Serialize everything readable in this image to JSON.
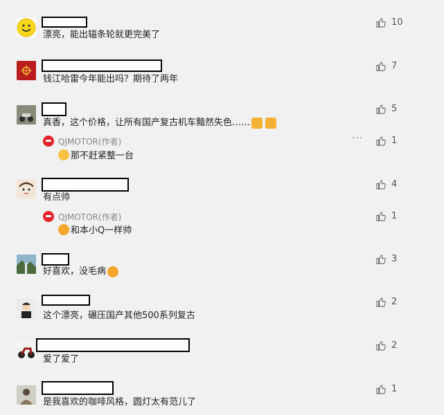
{
  "comments": [
    {
      "text": "漂亮，能出辐条轮就更完美了",
      "likes": "10",
      "avatar_icon": "smiley-face"
    },
    {
      "text": "钱江哈雷今年能出吗？期待了两年",
      "likes": "7",
      "avatar_icon": "red-emblem"
    },
    {
      "text": "真香，这个价格，让所有国产复古机车黯然失色……",
      "likes": "5",
      "avatar_icon": "motorcycle-photo",
      "reply": {
        "name": "QJMOTOR(作者)",
        "text": "那不赶紧整一台",
        "likes": "1"
      }
    },
    {
      "text": "有点帅",
      "likes": "4",
      "avatar_icon": "cartoon-face",
      "reply": {
        "name": "QJMOTOR(作者)",
        "text": "和本小Q一样帅",
        "likes": "1"
      }
    },
    {
      "text": "好喜欢，没毛病",
      "likes": "3",
      "avatar_icon": "landscape-photo"
    },
    {
      "text": "这个漂亮，碾压国产其他500系列复古",
      "likes": "2",
      "avatar_icon": "cartoon-person"
    },
    {
      "text": "爱了爱了",
      "likes": "2",
      "avatar_icon": "motorcycle-photo"
    },
    {
      "text": "是我喜欢的咖啡风格，圆灯太有范儿了",
      "likes": "1",
      "avatar_icon": "person-photo"
    }
  ],
  "more_label": "···",
  "colors": {
    "background": "#f1f1f1",
    "brand_red": "#e3242b"
  }
}
